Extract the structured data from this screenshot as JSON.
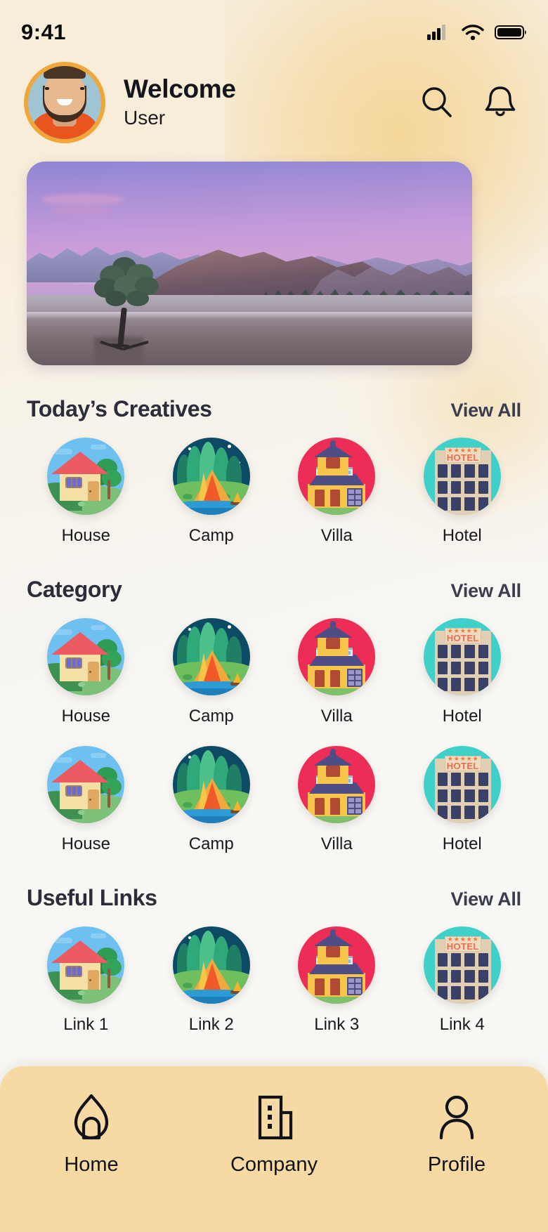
{
  "status_bar": {
    "time": "9:41",
    "icons": [
      "cellular-signal-icon",
      "wifi-icon",
      "battery-icon"
    ]
  },
  "header": {
    "avatar_alt": "user-avatar",
    "greeting": "Welcome",
    "username": "User",
    "search_icon": "search-icon",
    "notification_icon": "bell-icon"
  },
  "banner": {
    "alt": "lone-tree-lake-sunset-banner"
  },
  "sections": [
    {
      "title": "Today’s Creatives",
      "view_all": "View All",
      "items": [
        {
          "label": "House",
          "icon": "house-illustration-icon"
        },
        {
          "label": "Camp",
          "icon": "camp-tent-illustration-icon"
        },
        {
          "label": "Villa",
          "icon": "villa-illustration-icon"
        },
        {
          "label": "Hotel",
          "icon": "hotel-building-illustration-icon"
        }
      ]
    },
    {
      "title": "Category",
      "view_all": "View All",
      "items": [
        {
          "label": "House",
          "icon": "house-illustration-icon"
        },
        {
          "label": "Camp",
          "icon": "camp-tent-illustration-icon"
        },
        {
          "label": "Villa",
          "icon": "villa-illustration-icon"
        },
        {
          "label": "Hotel",
          "icon": "hotel-building-illustration-icon"
        },
        {
          "label": "House",
          "icon": "house-illustration-icon"
        },
        {
          "label": "Camp",
          "icon": "camp-tent-illustration-icon"
        },
        {
          "label": "Villa",
          "icon": "villa-illustration-icon"
        },
        {
          "label": "Hotel",
          "icon": "hotel-building-illustration-icon"
        }
      ]
    },
    {
      "title": "Useful Links",
      "view_all": "View All",
      "items": [
        {
          "label": "Link 1",
          "icon": "house-illustration-icon"
        },
        {
          "label": "Link 2",
          "icon": "camp-tent-illustration-icon"
        },
        {
          "label": "Link 3",
          "icon": "villa-illustration-icon"
        },
        {
          "label": "Link 4",
          "icon": "hotel-building-illustration-icon"
        }
      ]
    }
  ],
  "bottom_nav": {
    "items": [
      {
        "label": "Home",
        "icon": "home-icon"
      },
      {
        "label": "Company",
        "icon": "building-icon"
      },
      {
        "label": "Profile",
        "icon": "person-icon"
      }
    ]
  },
  "colors": {
    "bg_top": "#f7edda",
    "bg_bottom": "#f9f8f6",
    "nav_bar": "#f7d9a4",
    "avatar_ring": "#f0a73a",
    "title_text": "#2b2d3a",
    "banner_sky": "#c49ada"
  }
}
